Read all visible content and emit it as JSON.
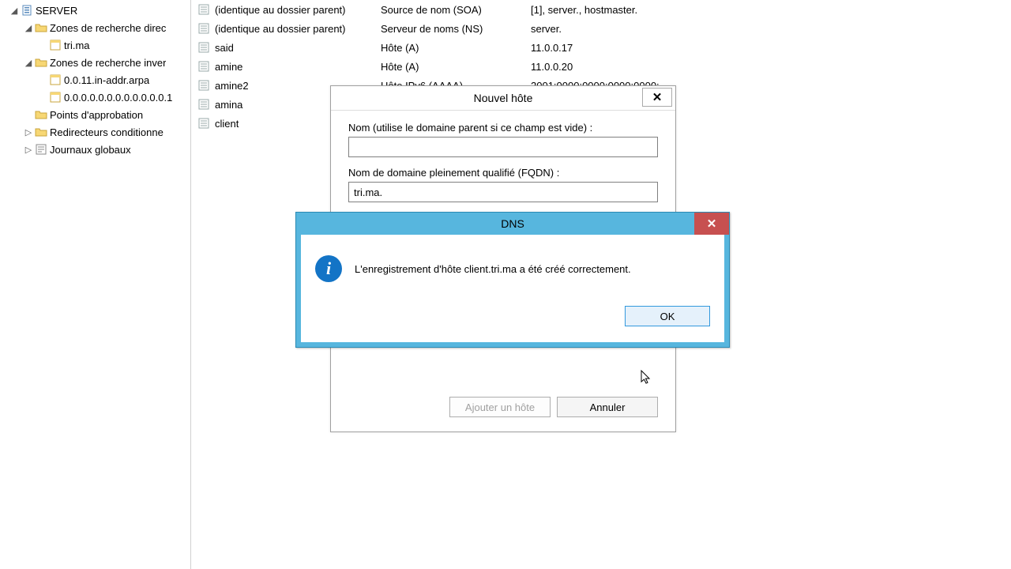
{
  "tree": {
    "server_label": "SERVER",
    "forward_label": "Zones de recherche direc",
    "forward_zone": "tri.ma",
    "reverse_label": "Zones de recherche inver",
    "reverse_zone1": "0.0.11.in-addr.arpa",
    "reverse_zone2": "0.0.0.0.0.0.0.0.0.0.0.0.1",
    "trust_label": "Points d'approbation",
    "cond_label": "Redirecteurs conditionne",
    "logs_label": "Journaux globaux"
  },
  "list": {
    "rows": [
      {
        "name": "(identique au dossier parent)",
        "type": "Source de nom (SOA)",
        "data": "[1], server., hostmaster."
      },
      {
        "name": "(identique au dossier parent)",
        "type": "Serveur de noms (NS)",
        "data": "server."
      },
      {
        "name": "said",
        "type": "Hôte (A)",
        "data": "11.0.0.17"
      },
      {
        "name": "amine",
        "type": "Hôte (A)",
        "data": "11.0.0.20"
      },
      {
        "name": "amine2",
        "type": "Hôte IPv6 (AAAA)",
        "data": "2001:0000:0000:0000:0000:"
      },
      {
        "name": "amina",
        "type": "",
        "data": ""
      },
      {
        "name": "client",
        "type": "",
        "data": ""
      }
    ]
  },
  "dlg_host": {
    "title": "Nouvel hôte",
    "name_label": "Nom (utilise le domaine parent si ce champ est vide) :",
    "name_value": "",
    "fqdn_label": "Nom de domaine pleinement qualifié (FQDN) :",
    "fqdn_value": "tri.ma.",
    "add_label": "Ajouter un hôte",
    "cancel_label": "Annuler"
  },
  "dlg_dns": {
    "title": "DNS",
    "message": "L'enregistrement d'hôte client.tri.ma a été créé correctement.",
    "ok_label": "OK"
  }
}
